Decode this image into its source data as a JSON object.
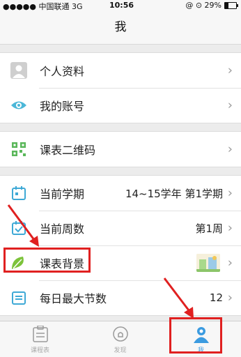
{
  "status_bar": {
    "carrier": "●●●●● 中国联通  3G",
    "time": "10:56",
    "right": "@ ⊙ 29%"
  },
  "nav": {
    "title": "我"
  },
  "groups": [
    {
      "rows": [
        {
          "label": "个人资料",
          "icon": "avatar-icon"
        },
        {
          "label": "我的账号",
          "icon": "account-eye-icon"
        }
      ]
    },
    {
      "rows": [
        {
          "label": "课表二维码",
          "icon": "qr-code-icon"
        }
      ]
    },
    {
      "rows": [
        {
          "label": "当前学期",
          "value": "14~15学年 第1学期",
          "icon": "calendar-icon"
        },
        {
          "label": "当前周数",
          "value": "第1周",
          "icon": "check-calendar-icon"
        },
        {
          "label": "课表背景",
          "icon": "leaf-icon"
        },
        {
          "label": "每日最大节数",
          "value": "12",
          "icon": "list-icon"
        }
      ]
    }
  ],
  "tabs": [
    {
      "label": "课程表",
      "icon": "timetable-icon"
    },
    {
      "label": "发现",
      "icon": "bulb-icon"
    },
    {
      "label": "我",
      "icon": "user-icon"
    }
  ],
  "colors": {
    "accent": "#3b9be0",
    "annotation": "#e02020"
  },
  "chevron": "›"
}
